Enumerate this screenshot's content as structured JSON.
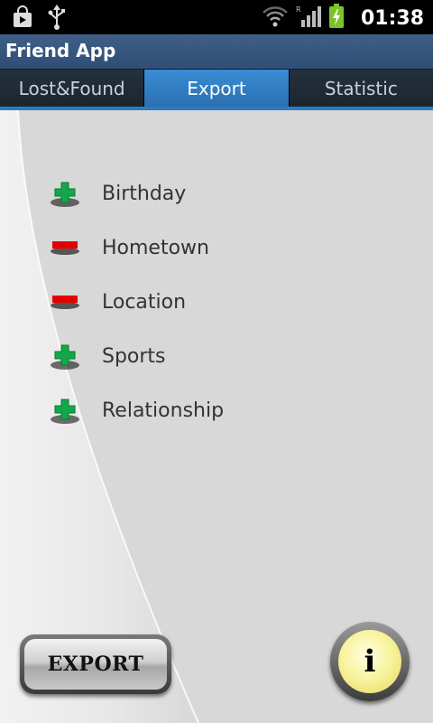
{
  "status_bar": {
    "time": "01:38",
    "left_icons": [
      "shopping-bag-icon",
      "usb-icon"
    ],
    "right_icons": [
      "wifi-icon",
      "signal-icon",
      "battery-charging-icon"
    ]
  },
  "app": {
    "title": "Friend App"
  },
  "tabs": [
    {
      "label": "Lost&Found",
      "active": false
    },
    {
      "label": "Export",
      "active": true
    },
    {
      "label": "Statistic",
      "active": false
    }
  ],
  "items": [
    {
      "label": "Birthday",
      "state": "plus"
    },
    {
      "label": "Hometown",
      "state": "minus"
    },
    {
      "label": "Location",
      "state": "minus"
    },
    {
      "label": "Sports",
      "state": "plus"
    },
    {
      "label": "Relationship",
      "state": "plus"
    }
  ],
  "buttons": {
    "export_label": "EXPORT",
    "info_glyph": "i"
  },
  "colors": {
    "plus": "#12a84a",
    "minus": "#e50000",
    "active_tab": "#2f7bc0",
    "title_bar": "#33547d"
  }
}
